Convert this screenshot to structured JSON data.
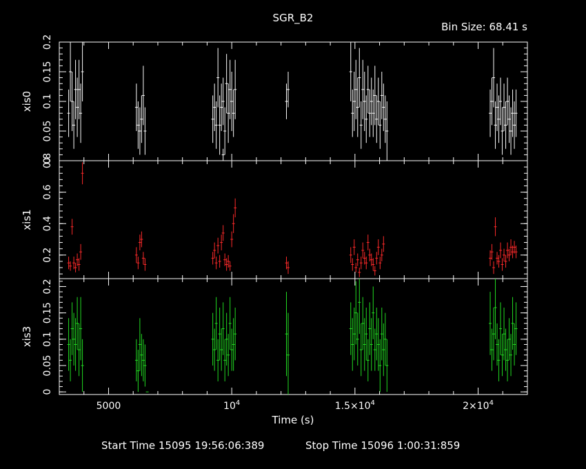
{
  "chart_data": {
    "type": "scatter",
    "title": "SGR_B2",
    "bin_size_label": "Bin Size: 68.41 s",
    "xlabel": "Time (s)",
    "xlim": [
      3000,
      22000
    ],
    "x_ticks": [
      {
        "value": 5000,
        "base": "5000",
        "sup": ""
      },
      {
        "value": 10000,
        "base": "10",
        "sup": "4"
      },
      {
        "value": 15000,
        "base": "1.5×10",
        "sup": "4"
      },
      {
        "value": 20000,
        "base": "2×10",
        "sup": "4"
      }
    ],
    "footer": {
      "start_label": "Start Time 15095 19:56:06:389",
      "stop_label": "Stop Time 15096  1:00:31:859"
    },
    "panels": [
      {
        "name": "xis0",
        "color": "#ffffff",
        "ylim": [
          0,
          0.2
        ],
        "ticks": [
          0,
          0.05,
          0.1,
          0.15,
          0.2
        ],
        "tick_labels": [
          "0",
          "0.05",
          "0.1",
          "0.15",
          "0.2"
        ],
        "points": [
          [
            3380,
            0.08,
            0.04
          ],
          [
            3450,
            0.15,
            0.05
          ],
          [
            3520,
            0.1,
            0.05
          ],
          [
            3590,
            0.06,
            0.04
          ],
          [
            3660,
            0.12,
            0.05
          ],
          [
            3730,
            0.09,
            0.05
          ],
          [
            3800,
            0.12,
            0.05
          ],
          [
            3870,
            0.08,
            0.05
          ],
          [
            3940,
            0.15,
            0.05
          ],
          [
            6130,
            0.09,
            0.04
          ],
          [
            6200,
            0.06,
            0.04
          ],
          [
            6270,
            0.05,
            0.04
          ],
          [
            6340,
            0.07,
            0.04
          ],
          [
            6410,
            0.11,
            0.05
          ],
          [
            6480,
            0.05,
            0.04
          ],
          [
            9230,
            0.07,
            0.04
          ],
          [
            9300,
            0.09,
            0.04
          ],
          [
            9370,
            0.06,
            0.04
          ],
          [
            9440,
            0.14,
            0.05
          ],
          [
            9510,
            0.06,
            0.05
          ],
          [
            9580,
            0.09,
            0.04
          ],
          [
            9650,
            0.1,
            0.04
          ],
          [
            9720,
            0.05,
            0.04
          ],
          [
            9790,
            0.13,
            0.05
          ],
          [
            9860,
            0.08,
            0.05
          ],
          [
            9930,
            0.12,
            0.05
          ],
          [
            10000,
            0.1,
            0.05
          ],
          [
            10070,
            0.08,
            0.04
          ],
          [
            10140,
            0.12,
            0.05
          ],
          [
            9650,
            0.01,
            0.01
          ],
          [
            12220,
            0.1,
            0.03
          ],
          [
            12290,
            0.12,
            0.03
          ],
          [
            14830,
            0.15,
            0.05
          ],
          [
            14900,
            0.08,
            0.04
          ],
          [
            14970,
            0.1,
            0.05
          ],
          [
            15040,
            0.12,
            0.05
          ],
          [
            15110,
            0.09,
            0.05
          ],
          [
            15180,
            0.14,
            0.05
          ],
          [
            15250,
            0.06,
            0.04
          ],
          [
            15320,
            0.12,
            0.05
          ],
          [
            15390,
            0.1,
            0.05
          ],
          [
            15460,
            0.07,
            0.04
          ],
          [
            15530,
            0.12,
            0.04
          ],
          [
            15600,
            0.08,
            0.04
          ],
          [
            15670,
            0.1,
            0.04
          ],
          [
            15740,
            0.08,
            0.04
          ],
          [
            15810,
            0.11,
            0.05
          ],
          [
            15880,
            0.07,
            0.04
          ],
          [
            15950,
            0.1,
            0.04
          ],
          [
            16020,
            0.06,
            0.04
          ],
          [
            16090,
            0.11,
            0.04
          ],
          [
            16160,
            0.09,
            0.04
          ],
          [
            16230,
            0.07,
            0.04
          ],
          [
            16300,
            0.05,
            0.05
          ],
          [
            12400,
            0.0,
            0.0
          ],
          [
            20490,
            0.08,
            0.04
          ],
          [
            20560,
            0.1,
            0.04
          ],
          [
            20630,
            0.14,
            0.05
          ],
          [
            20700,
            0.06,
            0.04
          ],
          [
            20770,
            0.09,
            0.04
          ],
          [
            20840,
            0.07,
            0.04
          ],
          [
            20910,
            0.1,
            0.04
          ],
          [
            20980,
            0.05,
            0.04
          ],
          [
            21050,
            0.09,
            0.04
          ],
          [
            21120,
            0.06,
            0.04
          ],
          [
            21190,
            0.1,
            0.04
          ],
          [
            21260,
            0.07,
            0.04
          ],
          [
            21330,
            0.05,
            0.04
          ],
          [
            21400,
            0.08,
            0.04
          ],
          [
            21470,
            0.06,
            0.04
          ],
          [
            21540,
            0.08,
            0.04
          ]
        ]
      },
      {
        "name": "xis1",
        "color": "#ff2a2a",
        "ylim": [
          0.05,
          0.8
        ],
        "ticks": [
          0.2,
          0.4,
          0.6,
          0.8
        ],
        "tick_labels": [
          "0.2",
          "0.4",
          "0.6",
          "0.8"
        ],
        "points": [
          [
            3380,
            0.15,
            0.04
          ],
          [
            3450,
            0.13,
            0.03
          ],
          [
            3520,
            0.38,
            0.05
          ],
          [
            3590,
            0.15,
            0.04
          ],
          [
            3660,
            0.12,
            0.03
          ],
          [
            3730,
            0.17,
            0.04
          ],
          [
            3800,
            0.14,
            0.04
          ],
          [
            3870,
            0.22,
            0.05
          ],
          [
            3940,
            0.72,
            0.07
          ],
          [
            6130,
            0.2,
            0.05
          ],
          [
            6200,
            0.15,
            0.04
          ],
          [
            6270,
            0.28,
            0.05
          ],
          [
            6340,
            0.3,
            0.05
          ],
          [
            6410,
            0.18,
            0.04
          ],
          [
            6480,
            0.14,
            0.04
          ],
          [
            9230,
            0.18,
            0.04
          ],
          [
            9300,
            0.23,
            0.05
          ],
          [
            9370,
            0.15,
            0.04
          ],
          [
            9440,
            0.26,
            0.05
          ],
          [
            9510,
            0.16,
            0.04
          ],
          [
            9580,
            0.28,
            0.05
          ],
          [
            9650,
            0.34,
            0.05
          ],
          [
            9720,
            0.17,
            0.04
          ],
          [
            9790,
            0.14,
            0.04
          ],
          [
            9860,
            0.16,
            0.04
          ],
          [
            9930,
            0.13,
            0.03
          ],
          [
            10000,
            0.3,
            0.05
          ],
          [
            10070,
            0.4,
            0.06
          ],
          [
            10140,
            0.5,
            0.06
          ],
          [
            12220,
            0.15,
            0.04
          ],
          [
            12290,
            0.12,
            0.04
          ],
          [
            14830,
            0.2,
            0.05
          ],
          [
            14900,
            0.14,
            0.04
          ],
          [
            14970,
            0.25,
            0.05
          ],
          [
            15040,
            0.12,
            0.03
          ],
          [
            15110,
            0.17,
            0.04
          ],
          [
            15180,
            0.09,
            0.03
          ],
          [
            15250,
            0.15,
            0.04
          ],
          [
            15320,
            0.23,
            0.05
          ],
          [
            15390,
            0.18,
            0.04
          ],
          [
            15460,
            0.15,
            0.04
          ],
          [
            15530,
            0.28,
            0.05
          ],
          [
            15600,
            0.2,
            0.04
          ],
          [
            15670,
            0.17,
            0.04
          ],
          [
            15740,
            0.14,
            0.04
          ],
          [
            15810,
            0.1,
            0.03
          ],
          [
            15880,
            0.18,
            0.04
          ],
          [
            15950,
            0.25,
            0.05
          ],
          [
            16020,
            0.15,
            0.04
          ],
          [
            16090,
            0.2,
            0.04
          ],
          [
            16160,
            0.27,
            0.05
          ],
          [
            20490,
            0.18,
            0.05
          ],
          [
            20560,
            0.22,
            0.05
          ],
          [
            20630,
            0.12,
            0.04
          ],
          [
            20700,
            0.38,
            0.06
          ],
          [
            20770,
            0.18,
            0.04
          ],
          [
            20840,
            0.16,
            0.04
          ],
          [
            20910,
            0.23,
            0.05
          ],
          [
            20980,
            0.14,
            0.04
          ],
          [
            21050,
            0.2,
            0.04
          ],
          [
            21120,
            0.16,
            0.04
          ],
          [
            21190,
            0.23,
            0.05
          ],
          [
            21260,
            0.2,
            0.04
          ],
          [
            21330,
            0.25,
            0.05
          ],
          [
            21400,
            0.22,
            0.04
          ],
          [
            21470,
            0.25,
            0.04
          ],
          [
            21540,
            0.22,
            0.04
          ]
        ]
      },
      {
        "name": "xis3",
        "color": "#22dd22",
        "ylim": [
          -0.005,
          0.215
        ],
        "ticks": [
          0,
          0.05,
          0.1,
          0.15,
          0.2
        ],
        "tick_labels": [
          "0",
          "0.05",
          "0.1",
          "0.15",
          "0.2"
        ],
        "points": [
          [
            3380,
            0.09,
            0.05
          ],
          [
            3450,
            0.06,
            0.04
          ],
          [
            3520,
            0.12,
            0.05
          ],
          [
            3590,
            0.1,
            0.05
          ],
          [
            3660,
            0.09,
            0.05
          ],
          [
            3730,
            0.13,
            0.05
          ],
          [
            3800,
            0.08,
            0.05
          ],
          [
            3870,
            0.12,
            0.06
          ],
          [
            3940,
            0.05,
            0.05
          ],
          [
            6130,
            0.06,
            0.04
          ],
          [
            6200,
            0.04,
            0.04
          ],
          [
            6270,
            0.09,
            0.05
          ],
          [
            6340,
            0.07,
            0.04
          ],
          [
            6410,
            0.06,
            0.04
          ],
          [
            6480,
            0.05,
            0.04
          ],
          [
            6570,
            0.0,
            0.0
          ],
          [
            9230,
            0.1,
            0.05
          ],
          [
            9300,
            0.08,
            0.04
          ],
          [
            9370,
            0.13,
            0.05
          ],
          [
            9440,
            0.06,
            0.04
          ],
          [
            9510,
            0.11,
            0.05
          ],
          [
            9580,
            0.08,
            0.04
          ],
          [
            9650,
            0.12,
            0.05
          ],
          [
            9720,
            0.06,
            0.04
          ],
          [
            9790,
            0.1,
            0.05
          ],
          [
            9860,
            0.07,
            0.04
          ],
          [
            9930,
            0.13,
            0.05
          ],
          [
            10000,
            0.08,
            0.04
          ],
          [
            10070,
            0.09,
            0.05
          ],
          [
            10140,
            0.11,
            0.05
          ],
          [
            12220,
            0.11,
            0.08
          ],
          [
            12290,
            0.07,
            0.08
          ],
          [
            14830,
            0.12,
            0.05
          ],
          [
            14900,
            0.09,
            0.05
          ],
          [
            14970,
            0.11,
            0.05
          ],
          [
            15040,
            0.15,
            0.06
          ],
          [
            15110,
            0.1,
            0.05
          ],
          [
            15180,
            0.17,
            0.06
          ],
          [
            15250,
            0.08,
            0.05
          ],
          [
            15320,
            0.13,
            0.05
          ],
          [
            15390,
            0.09,
            0.05
          ],
          [
            15460,
            0.11,
            0.05
          ],
          [
            15530,
            0.06,
            0.04
          ],
          [
            15600,
            0.12,
            0.05
          ],
          [
            15670,
            0.09,
            0.05
          ],
          [
            15740,
            0.15,
            0.05
          ],
          [
            15810,
            0.08,
            0.04
          ],
          [
            15880,
            0.11,
            0.05
          ],
          [
            15950,
            0.09,
            0.05
          ],
          [
            16020,
            0.05,
            0.05
          ],
          [
            16090,
            0.11,
            0.05
          ],
          [
            16160,
            0.08,
            0.05
          ],
          [
            16230,
            0.1,
            0.05
          ],
          [
            16300,
            0.05,
            0.05
          ],
          [
            20490,
            0.13,
            0.06
          ],
          [
            20560,
            0.08,
            0.04
          ],
          [
            20630,
            0.11,
            0.05
          ],
          [
            20700,
            0.16,
            0.06
          ],
          [
            20770,
            0.09,
            0.04
          ],
          [
            20840,
            0.06,
            0.04
          ],
          [
            20910,
            0.12,
            0.05
          ],
          [
            20980,
            0.07,
            0.04
          ],
          [
            21050,
            0.11,
            0.05
          ],
          [
            21120,
            0.08,
            0.04
          ],
          [
            21190,
            0.06,
            0.04
          ],
          [
            21260,
            0.1,
            0.04
          ],
          [
            21330,
            0.07,
            0.04
          ],
          [
            21400,
            0.13,
            0.05
          ],
          [
            21470,
            0.09,
            0.04
          ],
          [
            21540,
            0.12,
            0.05
          ]
        ]
      }
    ]
  }
}
